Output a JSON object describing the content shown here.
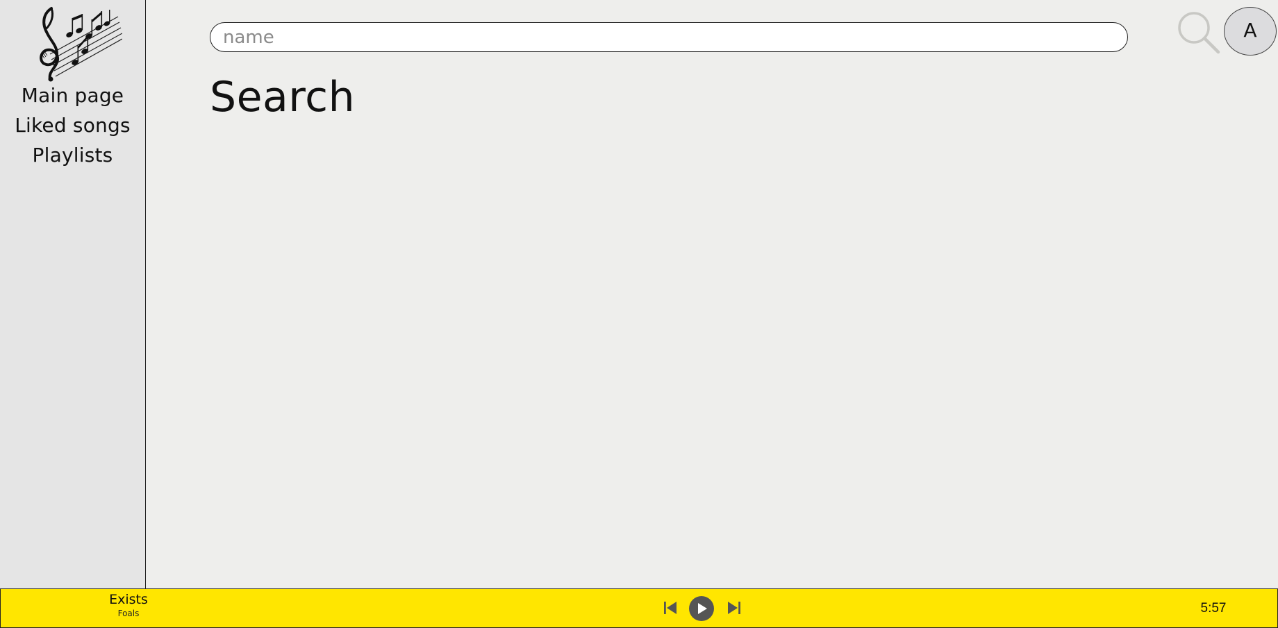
{
  "sidebar": {
    "logo_icon": "music-notes-treble-clef-icon",
    "items": [
      {
        "label": "Main page"
      },
      {
        "label": "Liked songs"
      },
      {
        "label": "Playlists"
      }
    ]
  },
  "header": {
    "search": {
      "placeholder": "name",
      "value": ""
    },
    "search_icon": "magnifier-icon",
    "avatar_initial": "A"
  },
  "main": {
    "title": "Search"
  },
  "player": {
    "track_title": "Exists",
    "track_artist": "Foals",
    "duration": "5:57",
    "controls": {
      "prev_icon": "skip-previous-icon",
      "play_icon": "play-icon",
      "next_icon": "skip-next-icon"
    },
    "background_color": "#ffe600"
  },
  "colors": {
    "sidebar_bg": "#e5e5e5",
    "main_bg": "#eeeeec",
    "player_bg": "#ffe600",
    "avatar_bg": "#dcdcde"
  }
}
